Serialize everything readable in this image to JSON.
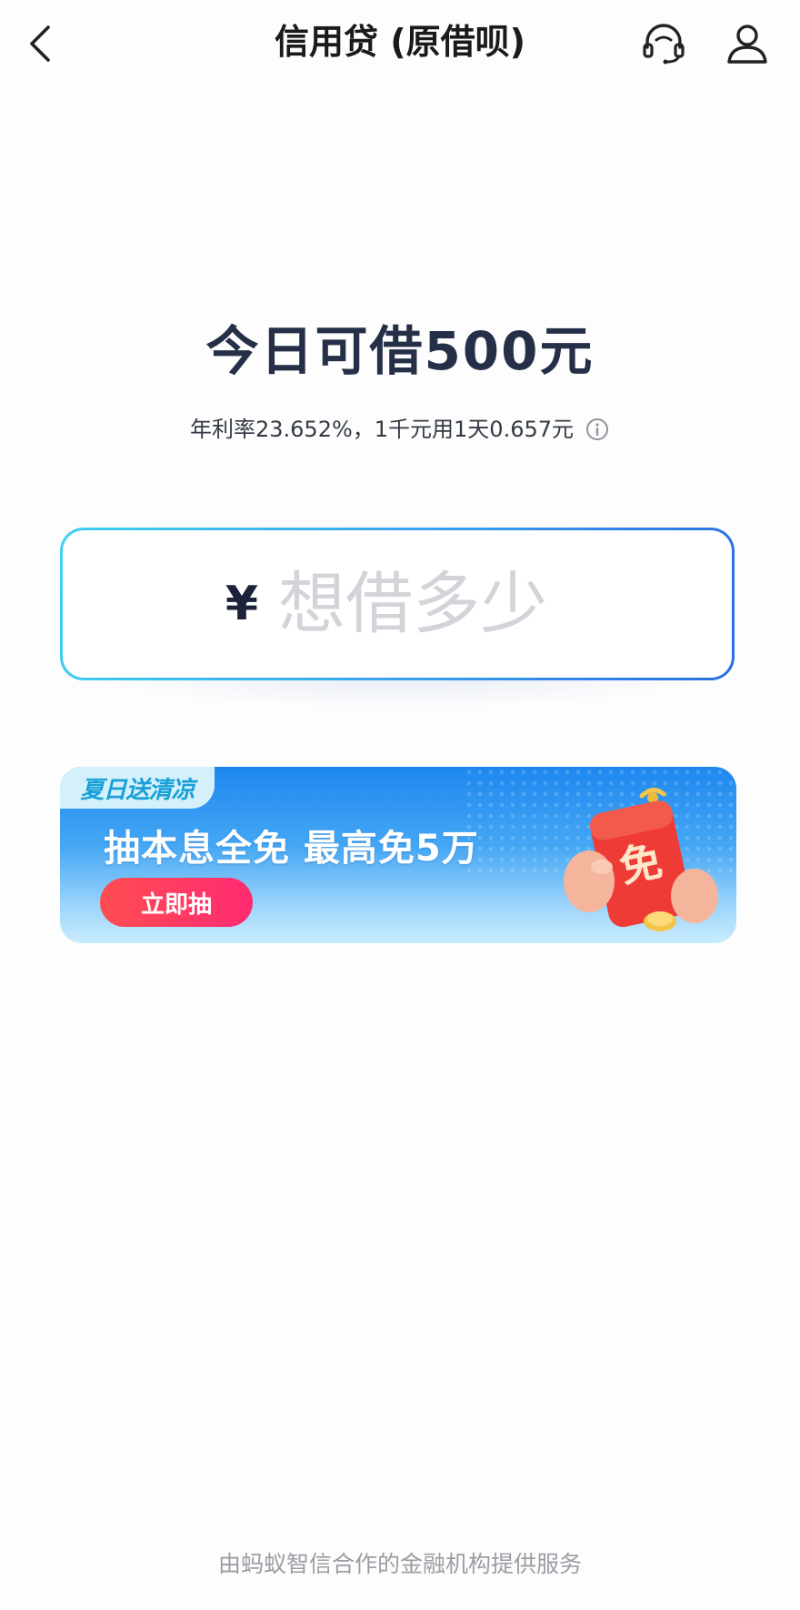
{
  "header": {
    "title": "信用贷 (原借呗)",
    "back_icon": "chevron-left-icon",
    "service_icon": "headset-icon",
    "user_icon": "user-icon"
  },
  "hero": {
    "headline": "今日可借500元",
    "rate_text": "年利率23.652%，1千元用1天0.657元",
    "info_icon": "info-icon"
  },
  "amount_input": {
    "currency": "¥",
    "placeholder": "想借多少",
    "value": ""
  },
  "promo": {
    "tag": "夏日送清凉",
    "title": "抽本息全免 最高免5万",
    "button_label": "立即抽",
    "art_text": "免"
  },
  "footer": {
    "text": "由蚂蚁智信合作的金融机构提供服务"
  },
  "colors": {
    "accent_blue": "#2a6fe0",
    "accent_cyan": "#3fd0f0",
    "promo_red": "#ff3a5e",
    "headline": "#253048"
  }
}
